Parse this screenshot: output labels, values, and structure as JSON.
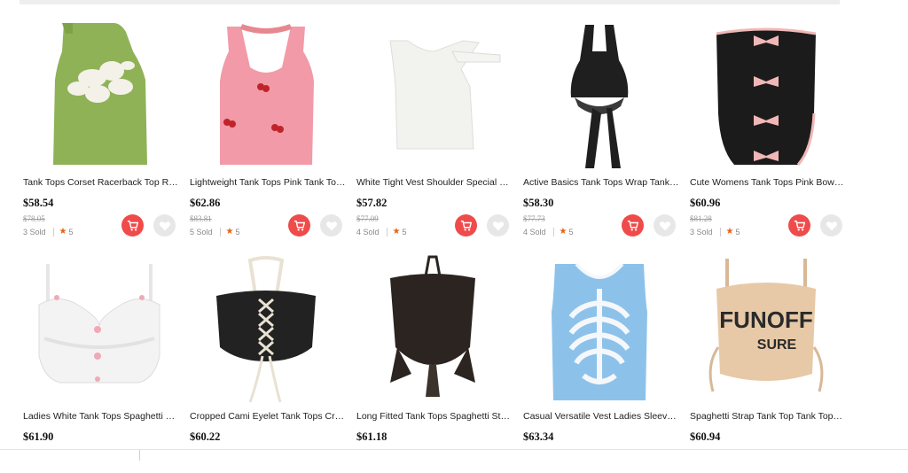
{
  "products": [
    {
      "title": "Tank Tops Corset Racerback Top Ro...",
      "price": "$58.54",
      "original_price": "$78.05",
      "sold": "3 Sold",
      "rating": "5",
      "image": "green-hibiscus-tank",
      "colors": {
        "main": "#8fb257",
        "accent": "#f3f1e8"
      }
    },
    {
      "title": "Lightweight Tank Tops Pink Tank Top...",
      "price": "$62.86",
      "original_price": "$83.81",
      "sold": "5 Sold",
      "rating": "5",
      "image": "pink-halter-cherry",
      "colors": {
        "main": "#f29aa8",
        "accent": "#c0242a"
      }
    },
    {
      "title": "White Tight Vest Shoulder Special D...",
      "price": "$57.82",
      "original_price": "$77.09",
      "sold": "4 Sold",
      "rating": "5",
      "image": "white-asymmetric-vest",
      "colors": {
        "main": "#f2f2ee",
        "accent": "#dddddd"
      }
    },
    {
      "title": "Active Basics Tank Tops Wrap Tank ...",
      "price": "$58.30",
      "original_price": "$77.73",
      "sold": "4 Sold",
      "rating": "5",
      "image": "black-wrap-halter",
      "colors": {
        "main": "#1f1f1f",
        "accent": "#3a3a3a"
      }
    },
    {
      "title": "Cute Womens Tank Tops Pink Bow-k...",
      "price": "$60.96",
      "original_price": "$81.28",
      "sold": "3 Sold",
      "rating": "5",
      "image": "black-corset-pink-bows",
      "colors": {
        "main": "#1b1b1b",
        "accent": "#f1b7b7"
      }
    },
    {
      "title": "Ladies White Tank Tops Spaghetti St...",
      "price": "$61.90",
      "image": "white-lace-camisole",
      "colors": {
        "main": "#f3f3f3",
        "accent": "#f0a9b6"
      }
    },
    {
      "title": "Cropped Cami Eyelet Tank Tops Cris...",
      "price": "$60.22",
      "image": "black-lace-up-halter",
      "colors": {
        "main": "#222222",
        "accent": "#e9e2d2"
      }
    },
    {
      "title": "Long Fitted Tank Tops Spaghetti Stra...",
      "price": "$61.18",
      "image": "brown-ruched-halter",
      "colors": {
        "main": "#2b2420",
        "accent": "#3d332d"
      }
    },
    {
      "title": "Casual Versatile Vest Ladies Sleevel...",
      "price": "$63.34",
      "image": "blue-skeleton-sweater-vest",
      "colors": {
        "main": "#8cc2ea",
        "accent": "#f5f7fb"
      }
    },
    {
      "title": "Spaghetti Strap Tank Top Tank Tops ...",
      "price": "$60.94",
      "image": "beige-funoff-cami",
      "colors": {
        "main": "#e7c9a7",
        "accent": "#2a2a2a"
      },
      "print_text": [
        "FUNOFF",
        "SURE"
      ]
    }
  ],
  "icons": {
    "cart": "cart-icon",
    "wishlist": "heart-icon",
    "rating": "star-icon"
  },
  "theme": {
    "cart_button": "#ef4b4b",
    "wishlist_button": "#e7e7e7",
    "rating_star": "#e5631a"
  }
}
